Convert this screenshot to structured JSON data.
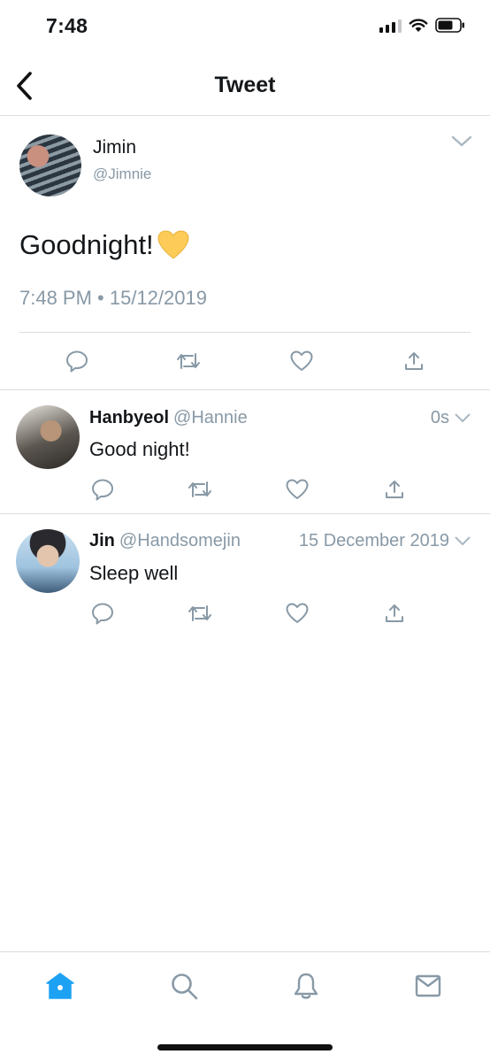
{
  "status_bar": {
    "time": "7:48"
  },
  "nav": {
    "title": "Tweet"
  },
  "main_tweet": {
    "name": "Jimin",
    "handle": "@Jimnie",
    "text": "Goodnight!",
    "emoji": "yellow-heart",
    "timestamp": "7:48 PM • 15/12/2019"
  },
  "replies": [
    {
      "name": "Hanbyeol",
      "handle": "@Hannie",
      "time": "0s",
      "text": "Good night!"
    },
    {
      "name": "Jin",
      "handle": "@Handsomejin",
      "time": "15 December 2019",
      "text": "Sleep well"
    }
  ],
  "tab_bar": {
    "items": [
      "home-icon",
      "search-icon",
      "notifications-bell-icon",
      "messages-mail-icon"
    ],
    "active": "home-icon"
  },
  "colors": {
    "accent": "#1da1f2",
    "icon_gray": "#8899a6",
    "divider": "#d9dde0"
  }
}
